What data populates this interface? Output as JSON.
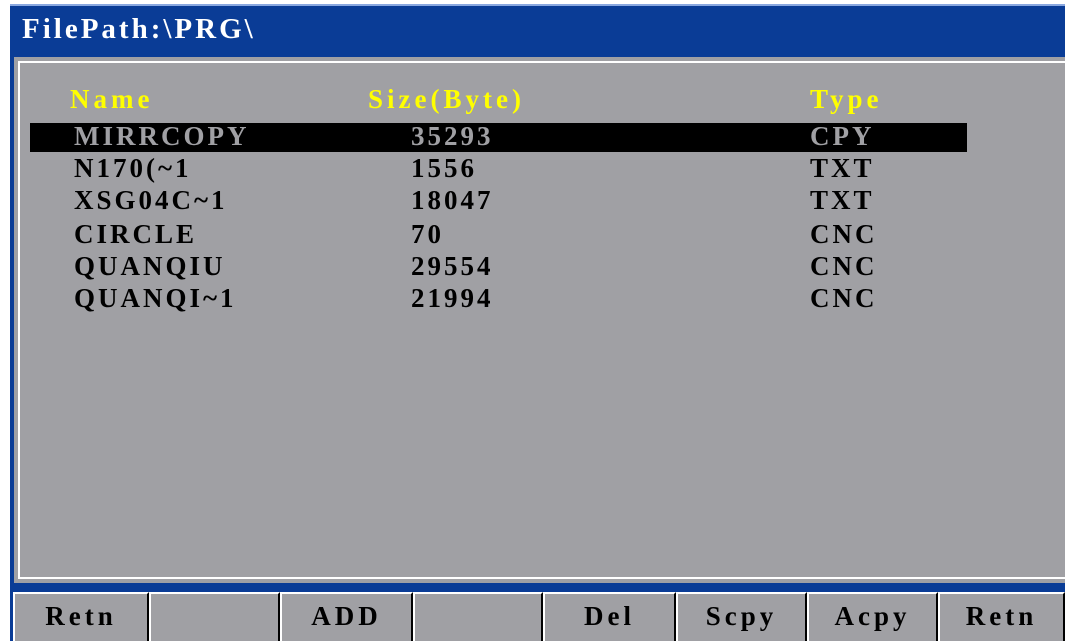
{
  "title": "FilePath:\\PRG\\",
  "columns": {
    "name": "Name",
    "size": "Size(Byte)",
    "type": "Type"
  },
  "files": [
    {
      "name": "MIRRCOPY",
      "size": "35293",
      "type": "CPY",
      "selected": true
    },
    {
      "name": "N170(~1",
      "size": "1556",
      "type": "TXT",
      "selected": false
    },
    {
      "name": "XSG04C~1",
      "size": "18047",
      "type": "TXT",
      "selected": false
    },
    {
      "name": "CIRCLE",
      "size": "70",
      "type": "CNC",
      "selected": false
    },
    {
      "name": "QUANQIU",
      "size": "29554",
      "type": "CNC",
      "selected": false
    },
    {
      "name": "QUANQI~1",
      "size": "21994",
      "type": "CNC",
      "selected": false
    }
  ],
  "softkeys": [
    {
      "label": "Retn"
    },
    {
      "label": ""
    },
    {
      "label": "ADD"
    },
    {
      "label": ""
    },
    {
      "label": "Del"
    },
    {
      "label": "Scpy"
    },
    {
      "label": "Acpy"
    },
    {
      "label": "Retn"
    }
  ],
  "colors": {
    "titlebar": "#0a3c96",
    "panel": "#a0a0a4",
    "header_text": "#ffff00",
    "selection": "#000000"
  }
}
